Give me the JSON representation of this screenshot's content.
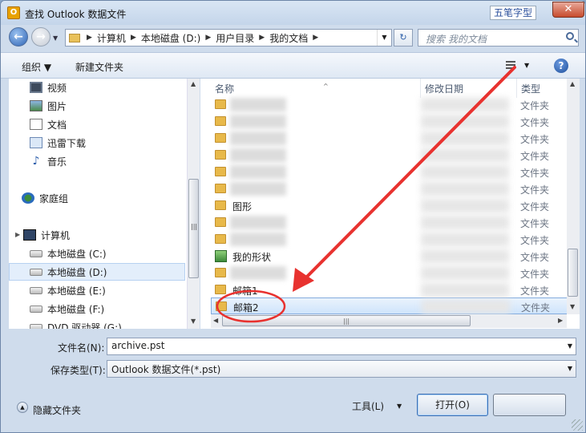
{
  "window": {
    "title": "查找 Outlook 数据文件",
    "app_icon_letter": "O",
    "close_glyph": "✕"
  },
  "ime": {
    "label": "五笔字型"
  },
  "nav": {
    "back_glyph": "←",
    "forward_glyph": "→",
    "history_glyph": "▼",
    "breadcrumbs": [
      "计算机",
      "本地磁盘 (D:)",
      "用户目录",
      "我的文档"
    ],
    "separator": "▶",
    "address_dropdown": "▼",
    "refresh_glyph": "↻",
    "search_placeholder": "搜索 我的文档"
  },
  "toolbar": {
    "organize": "组织 ▼",
    "new_folder": "新建文件夹",
    "view_dropdown": "▼",
    "help": "?"
  },
  "navpane": {
    "items": [
      {
        "label": "视频",
        "icon": "video-icon"
      },
      {
        "label": "图片",
        "icon": "picture-icon"
      },
      {
        "label": "文档",
        "icon": "document-icon"
      },
      {
        "label": "迅雷下载",
        "icon": "download-icon"
      },
      {
        "label": "音乐",
        "icon": "music-icon"
      },
      {
        "label": "家庭组",
        "icon": "homegroup-icon"
      },
      {
        "label": "计算机",
        "icon": "computer-icon"
      },
      {
        "label": "本地磁盘 (C:)",
        "icon": "drive-icon"
      },
      {
        "label": "本地磁盘 (D:)",
        "icon": "drive-icon",
        "selected": true
      },
      {
        "label": "本地磁盘 (E:)",
        "icon": "drive-icon"
      },
      {
        "label": "本地磁盘 (F:)",
        "icon": "drive-icon"
      },
      {
        "label": "DVD 驱动器 (G:)",
        "icon": "dvd-icon"
      }
    ],
    "music_glyph": "♪",
    "expander_glyph": "▶"
  },
  "filelist": {
    "columns": {
      "name": "名称",
      "date": "修改日期",
      "type": "类型"
    },
    "sort_glyph": "^",
    "rows": [
      {
        "name": "",
        "type": "文件夹",
        "kind": "folder"
      },
      {
        "name": "",
        "type": "文件夹",
        "kind": "folder"
      },
      {
        "name": "",
        "type": "文件夹",
        "kind": "folder"
      },
      {
        "name": "",
        "type": "文件夹",
        "kind": "folder"
      },
      {
        "name": "",
        "type": "文件夹",
        "kind": "folder"
      },
      {
        "name": "",
        "type": "文件夹",
        "kind": "folder"
      },
      {
        "name": "图形",
        "type": "文件夹",
        "kind": "folder"
      },
      {
        "name": "",
        "type": "文件夹",
        "kind": "folder"
      },
      {
        "name": "",
        "type": "文件夹",
        "kind": "folder"
      },
      {
        "name": "我的形状",
        "type": "文件夹",
        "kind": "special"
      },
      {
        "name": "",
        "type": "文件夹",
        "kind": "folder"
      },
      {
        "name": "邮箱1",
        "type": "文件夹",
        "kind": "folder"
      },
      {
        "name": "邮箱2",
        "type": "文件夹",
        "kind": "folder",
        "selected": true
      }
    ]
  },
  "scroll": {
    "up": "▲",
    "down": "▼",
    "left": "◀",
    "right": "▶",
    "grip": "|||"
  },
  "form": {
    "filename_label": "文件名(N):",
    "filename_value": "archive.pst",
    "savetype_label": "保存类型(T):",
    "savetype_value": "Outlook 数据文件(*.pst)",
    "dropdown_glyph": "▼"
  },
  "footer": {
    "hide_glyph": "▲",
    "hide_folders": "隐藏文件夹",
    "tools": "工具(L)",
    "tools_dropdown": "▼",
    "open": "打开(O)"
  },
  "annotation": {
    "color": "#e8322f"
  }
}
